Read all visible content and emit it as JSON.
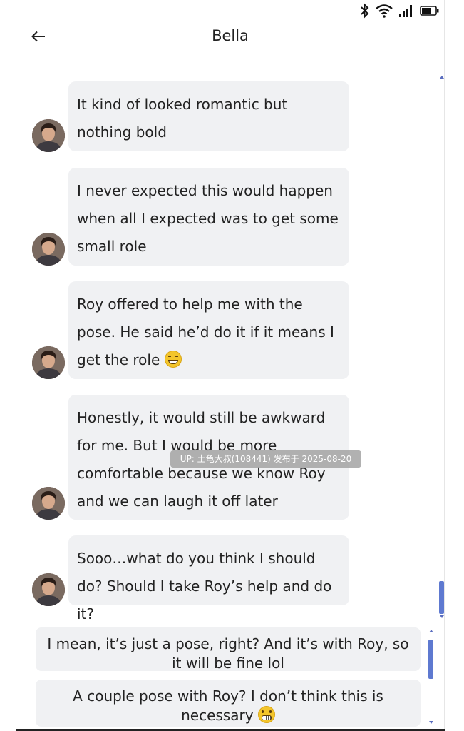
{
  "header": {
    "title": "Bella",
    "back_icon": "arrow-left-icon"
  },
  "status_bar": {
    "icons": [
      "bluetooth-icon",
      "wifi-icon",
      "signal-icon",
      "battery-icon"
    ]
  },
  "messages": [
    {
      "sender": "Bella",
      "text": "It kind of looked romantic but nothing bold"
    },
    {
      "sender": "Bella",
      "text": "I never expected this would happen when all I expected was to get some small role"
    },
    {
      "sender": "Bella",
      "text": "Roy offered to help me with the pose. He said he’d do it if it means I get the role",
      "emoji": "grinning-face"
    },
    {
      "sender": "Bella",
      "text": "Honestly, it would still be awkward for me. But I would be more comfortable because we know Roy and we can laugh it off later"
    },
    {
      "sender": "Bella",
      "text": "Sooo…what do you think I should do? Should I take Roy’s help and do it?"
    }
  ],
  "choices": [
    {
      "text": "I mean, it’s just a pose, right? And it’s with Roy, so it will be fine lol"
    },
    {
      "text": "A couple pose with Roy? I don’t think this is necessary",
      "emoji": "grimacing-face"
    }
  ],
  "watermark": "UP: 土龟大叔(108441) 发布于 2025-08-20",
  "colors": {
    "bubble": "#f0f1f3",
    "scrollbar": "#5e79d0"
  }
}
